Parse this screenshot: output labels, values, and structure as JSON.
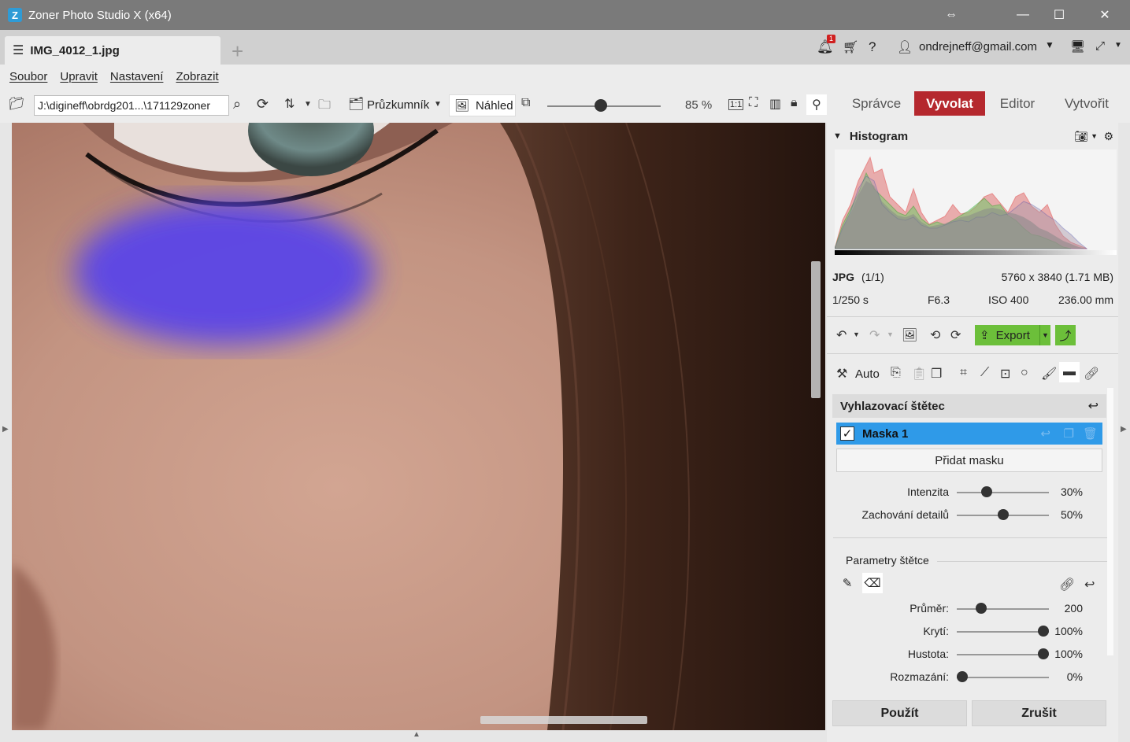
{
  "window": {
    "title": "Zoner Photo Studio X (x64)",
    "app_icon_glyph": "Z",
    "controls": [
      "⇔",
      "—",
      "☐",
      "✕"
    ]
  },
  "tabbar": {
    "doc_tab": "IMG_4012_1.jpg",
    "notification_count": "1",
    "account": "ondrejneff@gmail.com"
  },
  "menu": [
    "Soubor",
    "Upravit",
    "Nastavení",
    "Zobrazit"
  ],
  "toolbar": {
    "path": "J:\\digineff\\obrdg201...\\171129zoner",
    "explorer_label": "Průzkumník",
    "preview_label": "Náhled",
    "zoom": "85 %",
    "zoom_fraction": 0.47
  },
  "modules": [
    {
      "label": "Správce",
      "active": false
    },
    {
      "label": "Vyvolat",
      "active": true
    },
    {
      "label": "Editor",
      "active": false
    },
    {
      "label": "Vytvořit",
      "active": false
    }
  ],
  "histogram": {
    "title": "Histogram"
  },
  "file_info": {
    "format": "JPG",
    "index": "(1/1)",
    "dimensions": "5760 x 3840 (1.71 MB)",
    "shutter": "1/250 s",
    "aperture": "F6.3",
    "iso": "ISO 400",
    "focal": "236.00 mm"
  },
  "actions": {
    "export_label": "Export",
    "auto_label": "Auto"
  },
  "tool": {
    "title": "Vyhlazovací štětec",
    "mask_label": "Maska 1",
    "mask_checked": "✓",
    "add_mask": "Přidat masku",
    "sliders": [
      {
        "label": "Intenzita",
        "value": "30%",
        "fraction": 0.3
      },
      {
        "label": "Zachování detailů",
        "value": "50%",
        "fraction": 0.5
      }
    ],
    "brush_group": "Parametry štětce",
    "brush_sliders": [
      {
        "label": "Průměr:",
        "value": "200",
        "fraction": 0.23
      },
      {
        "label": "Krytí:",
        "value": "100%",
        "fraction": 1.0
      },
      {
        "label": "Hustota:",
        "value": "100%",
        "fraction": 1.0
      },
      {
        "label": "Rozmazání:",
        "value": "0%",
        "fraction": 0.0
      }
    ],
    "apply_label": "Použít",
    "cancel_label": "Zrušit"
  },
  "colors": {
    "active_module": "#b5282e",
    "mask_highlight": "#2f9ae8",
    "export_green": "#6cbf3a",
    "brush_overlay": "#5a44e8"
  }
}
